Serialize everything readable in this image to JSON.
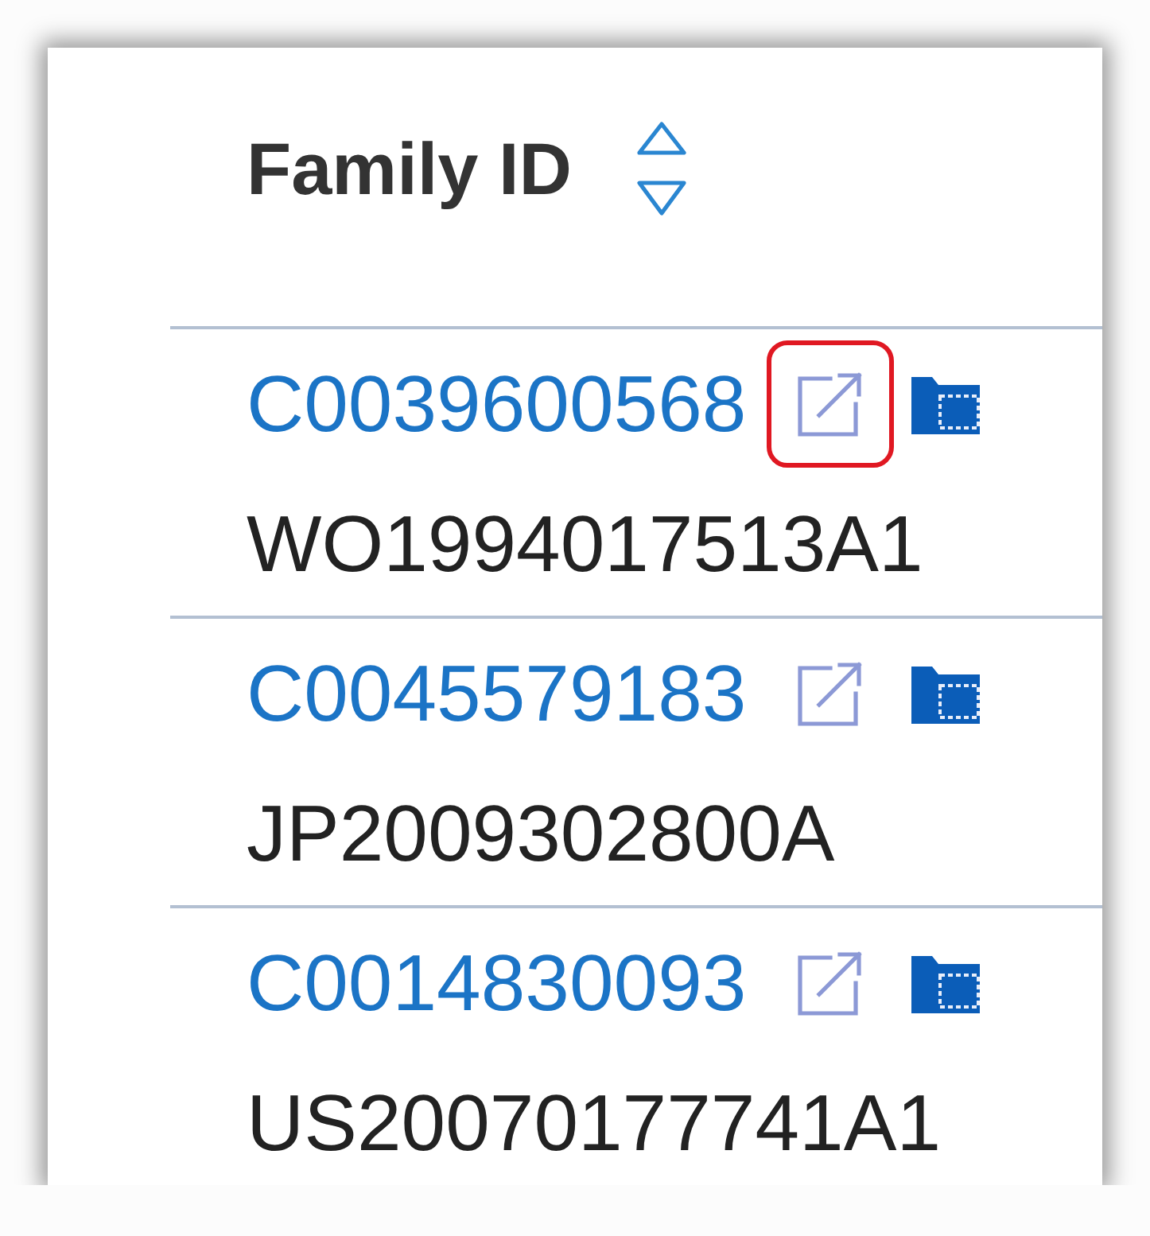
{
  "table": {
    "columns": [
      {
        "label": "Family ID",
        "sortable": true
      }
    ],
    "rows": [
      {
        "family_id": "C0039600568",
        "publication": "WO1994017513A1",
        "highlighted": true
      },
      {
        "family_id": "C0045579183",
        "publication": "JP2009302800A",
        "highlighted": false
      },
      {
        "family_id": "C0014830093",
        "publication": "US20070177741A1",
        "highlighted": false
      }
    ]
  }
}
